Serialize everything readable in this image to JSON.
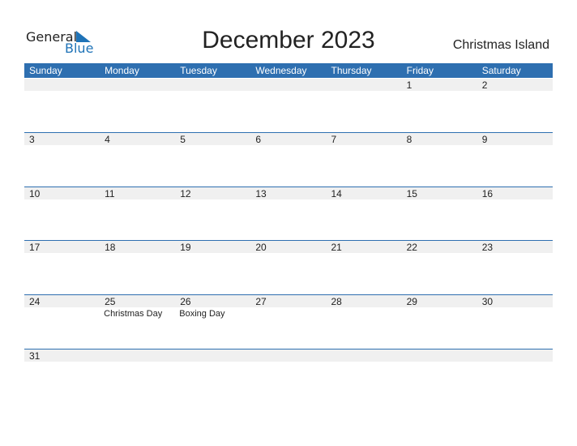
{
  "logo": {
    "line1": "General",
    "line2": "Blue",
    "icon": "triangle-flag-icon"
  },
  "title": "December 2023",
  "country": "Christmas Island",
  "colors": {
    "accent": "#2e6fb0",
    "band": "#f0f0f0"
  },
  "weekdays": [
    "Sunday",
    "Monday",
    "Tuesday",
    "Wednesday",
    "Thursday",
    "Friday",
    "Saturday"
  ],
  "weeks": [
    [
      {
        "d": ""
      },
      {
        "d": ""
      },
      {
        "d": ""
      },
      {
        "d": ""
      },
      {
        "d": ""
      },
      {
        "d": "1"
      },
      {
        "d": "2"
      }
    ],
    [
      {
        "d": "3"
      },
      {
        "d": "4"
      },
      {
        "d": "5"
      },
      {
        "d": "6"
      },
      {
        "d": "7"
      },
      {
        "d": "8"
      },
      {
        "d": "9"
      }
    ],
    [
      {
        "d": "10"
      },
      {
        "d": "11"
      },
      {
        "d": "12"
      },
      {
        "d": "13"
      },
      {
        "d": "14"
      },
      {
        "d": "15"
      },
      {
        "d": "16"
      }
    ],
    [
      {
        "d": "17"
      },
      {
        "d": "18"
      },
      {
        "d": "19"
      },
      {
        "d": "20"
      },
      {
        "d": "21"
      },
      {
        "d": "22"
      },
      {
        "d": "23"
      }
    ],
    [
      {
        "d": "24"
      },
      {
        "d": "25",
        "h": "Christmas Day"
      },
      {
        "d": "26",
        "h": "Boxing Day"
      },
      {
        "d": "27"
      },
      {
        "d": "28"
      },
      {
        "d": "29"
      },
      {
        "d": "30"
      }
    ],
    [
      {
        "d": "31"
      },
      {
        "d": ""
      },
      {
        "d": ""
      },
      {
        "d": ""
      },
      {
        "d": ""
      },
      {
        "d": ""
      },
      {
        "d": ""
      }
    ]
  ]
}
